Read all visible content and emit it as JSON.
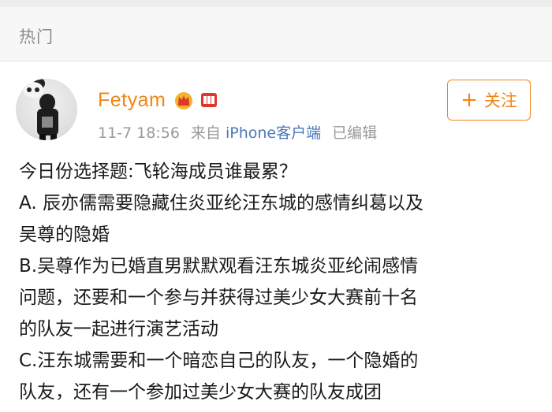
{
  "header": {
    "section_title": "热门"
  },
  "post": {
    "username": "Fetyam",
    "badges": [
      "crown-vip-icon",
      "gift-badge-icon"
    ],
    "timestamp": "11-7 18:56",
    "source_prefix": "来自",
    "source": "iPhone客户端",
    "edited": "已编辑",
    "follow_label": "关注",
    "content": {
      "line_intro": "今日份选择题:飞轮海成员谁最累？",
      "line_a1": "A. 辰亦儒需要隐藏住炎亚纶汪东城的感情纠葛以及",
      "line_a2": "吴尊的隐婚",
      "line_b1": "B.吴尊作为已婚直男默默观看汪东城炎亚纶闹感情",
      "line_b2": "问题，还要和一个参与并获得过美少女大赛前十名",
      "line_b3": "的队友一起进行演艺活动",
      "line_c1": "C.汪东城需要和一个暗恋自己的队友，一个隐婚的",
      "line_c2": "队友，还有一个参加过美少女大赛的队友成团"
    }
  },
  "colors": {
    "username": "#f08519",
    "source_link": "#4d79b8",
    "meta": "#9a9a9a",
    "follow_border": "#f08519"
  }
}
